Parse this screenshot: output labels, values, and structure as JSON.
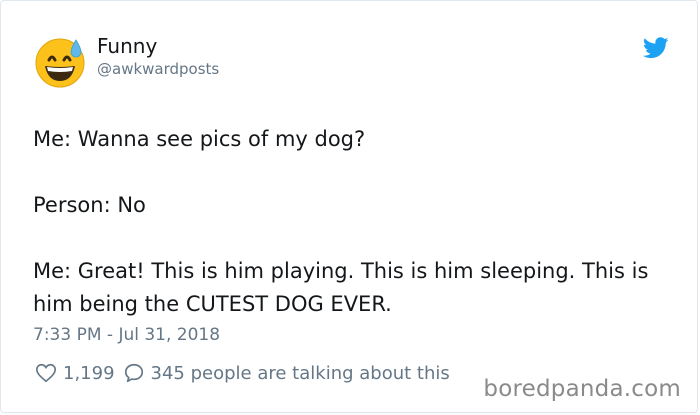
{
  "tweet": {
    "display_name": "Funny",
    "handle": "@awkwardposts",
    "lines": [
      "Me: Wanna see pics of my dog?",
      "Person: No",
      "Me: Great! This is him playing. This is him sleeping. This is him being the CUTEST DOG EVER."
    ],
    "timestamp": "7:33 PM - Jul 31, 2018",
    "likes": "1,199",
    "talking": "345 people are talking about this"
  },
  "icons": {
    "avatar": "grinning-sweat-emoji",
    "brand": "twitter-bird-icon",
    "like": "heart-icon",
    "reply": "comment-bubble-icon"
  },
  "watermark": "boredpanda.com",
  "colors": {
    "brand_blue": "#1da1f2",
    "muted_text": "#657786",
    "primary_text": "#14171a",
    "emoji_yellow": "#fcc21b",
    "sweat_blue": "#5fb8e8"
  }
}
